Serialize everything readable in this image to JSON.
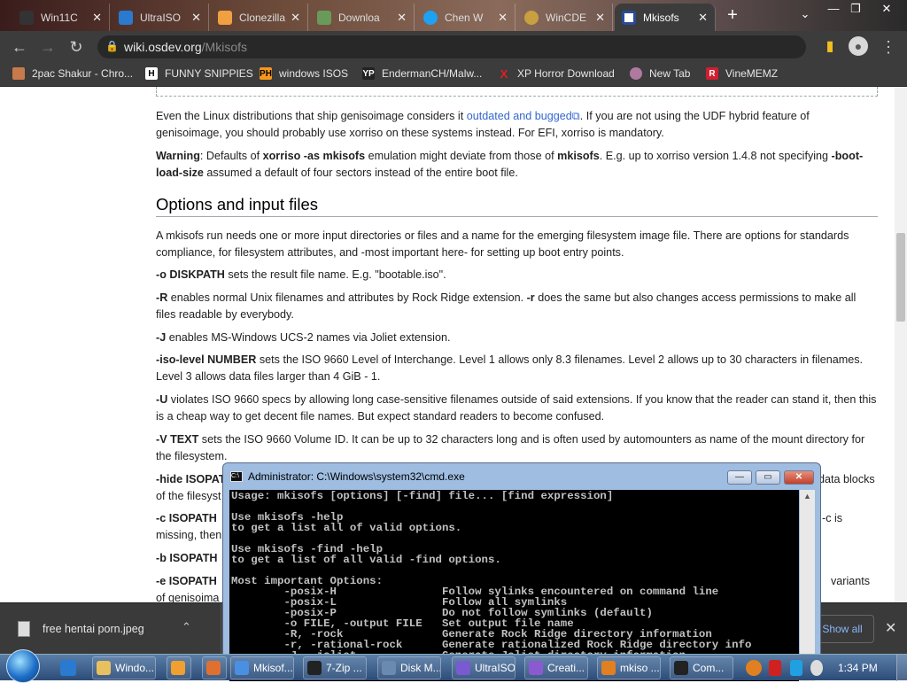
{
  "browser": {
    "tabs": [
      {
        "label": "Win11C"
      },
      {
        "label": "UltraISO"
      },
      {
        "label": "Clonezilla"
      },
      {
        "label": "Downloa"
      },
      {
        "label": "Chen W"
      },
      {
        "label": "WinCDE"
      },
      {
        "label": "Mkisofs"
      }
    ],
    "url_domain": "wiki.osdev.org",
    "url_path": "/Mkisofs",
    "bookmarks": [
      {
        "label": "2pac Shakur - Chro...",
        "icon": "H"
      },
      {
        "label": "FUNNY SNIPPIES",
        "icon": "H"
      },
      {
        "label": "windows ISOS",
        "icon": "PH"
      },
      {
        "label": "EndermanCH/Malw...",
        "icon": "YP"
      },
      {
        "label": "XP Horror Download",
        "icon": "X"
      },
      {
        "label": "New Tab",
        "icon": "globe"
      },
      {
        "label": "VineMEMZ",
        "icon": "R"
      }
    ]
  },
  "article": {
    "p1_pre": "Even the Linux distributions that ship genisoimage considers it ",
    "p1_link": "outdated and bugged",
    "p1_post": ". If you are not using the UDF hybrid feature of genisoimage, you should probably use xorriso on these systems instead. For EFI, xorriso is mandatory.",
    "warn_label": "Warning",
    "warn_1": ": Defaults of ",
    "warn_b1": "xorriso -as mkisofs",
    "warn_2": " emulation might deviate from those of ",
    "warn_b2": "mkisofs",
    "warn_3": ". E.g. up to xorriso version 1.4.8 not specifying ",
    "warn_b3": "-boot-load-size",
    "warn_4": " assumed a default of four sectors instead of the entire boot file.",
    "heading": "Options and input files",
    "intro": "A mkisofs run needs one or more input directories or files and a name for the emerging filesystem image file. There are options for standards compliance, for filesystem attributes, and -most important here- for setting up boot entry points.",
    "o_opt": "-o DISKPATH",
    "o_text": " sets the result file name. E.g. \"bootable.iso\".",
    "R_opt": "-R",
    "R_text1": " enables normal Unix filenames and attributes by Rock Ridge extension. ",
    "r_opt": "-r",
    "R_text2": " does the same but also changes access permissions to make all files readable by everybody.",
    "J_opt": "-J",
    "J_text": " enables MS-Windows UCS-2 names via Joliet extension.",
    "iso_opt": "-iso-level NUMBER",
    "iso_text": " sets the ISO 9660 Level of Interchange. Level 1 allows only 8.3 filenames. Level 2 allows up to 30 characters in filenames. Level 3 allows data files larger than 4 GiB - 1.",
    "U_opt": "-U",
    "U_text": " violates ISO 9660 specs by allowing long case-sensitive filenames outside of said extensions. If you know that the reader can stand it, then this is a cheap way to get decent file names. But expect standard readers to become confused.",
    "V_opt": "-V TEXT",
    "V_text": " sets the ISO 9660 Volume ID. It can be up to 32 characters long and is often used by automounters as name of the mount directory for the filesystem.",
    "hide_opt": "-hide ISOPAT",
    "hide_tail": "data blocks",
    "hide_line2": "of the filesyst",
    "c_opt": "-c ISOPATH",
    "c_tail": "-c is",
    "c_line2": "missing, then",
    "b_opt": "-b ISOPATH",
    "e_opt": "-e ISOPATH",
    "e_tail": "variants",
    "e_line2": "of genisoima"
  },
  "cmd": {
    "title": "Administrator: C:\\Windows\\system32\\cmd.exe",
    "lines": [
      "Usage: mkisofs [options] [-find] file... [find expression]",
      "",
      "Use mkisofs -help",
      "to get a list all of valid options.",
      "",
      "Use mkisofs -find -help",
      "to get a list of all valid -find options.",
      "",
      "Most important Options:",
      "        -posix-H                Follow sylinks encountered on command line",
      "        -posix-L                Follow all symlinks",
      "        -posix-P                Do not follow symlinks (default)",
      "        -o FILE, -output FILE   Set output file name",
      "        -R, -rock               Generate Rock Ridge directory information",
      "        -r, -rational-rock      Generate rationalized Rock Ridge directory info",
      "        -J, -joliet             Generate Joliet directory information"
    ]
  },
  "download": {
    "filename": "free hentai porn.jpeg",
    "show_all": "Show all"
  },
  "taskbar": {
    "items": [
      {
        "label": "Windo...",
        "color": "#e8c060"
      },
      {
        "label": "",
        "color": "#f0a030"
      },
      {
        "label": "",
        "color": "#e07030"
      },
      {
        "label": "Mkisof...",
        "color": "#4a90e2"
      },
      {
        "label": "7-Zip ...",
        "color": "#222"
      },
      {
        "label": "Disk M...",
        "color": "#6a8ab0"
      },
      {
        "label": "UltraISO",
        "color": "#7a5ad0"
      },
      {
        "label": "Creati...",
        "color": "#8a5ad0"
      },
      {
        "label": "mkiso ...",
        "color": "#e08020"
      },
      {
        "label": "Com...",
        "color": "#222"
      }
    ],
    "clock": "1:34 PM"
  }
}
